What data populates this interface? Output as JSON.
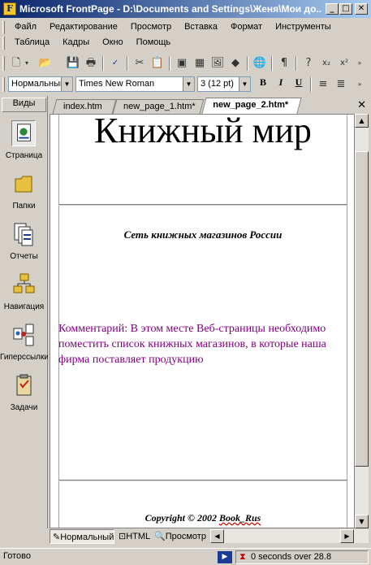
{
  "window": {
    "title": "Microsoft FrontPage - D:\\Documents and Settings\\Женя\\Мои до...",
    "minimize": "_",
    "maximize": "□",
    "close": "✕"
  },
  "menu": {
    "row1": [
      "Файл",
      "Редактирование",
      "Просмотр",
      "Вставка",
      "Формат",
      "Инструменты"
    ],
    "row2": [
      "Таблица",
      "Кадры",
      "Окно",
      "Помощь"
    ]
  },
  "format_toolbar": {
    "style": "Нормальный",
    "font": "Times New Roman",
    "size": "3  (12 pt)",
    "bold": "B",
    "italic": "I",
    "underline": "U"
  },
  "views": {
    "header": "Виды",
    "items": [
      "Страница",
      "Папки",
      "Отчеты",
      "Навигация",
      "Гиперссылки",
      "Задачи"
    ]
  },
  "tabs": [
    "index.htm",
    "new_page_1.htm*",
    "new_page_2.htm*"
  ],
  "page": {
    "heading": "Книжный мир",
    "subheading": "Сеть книжных магазинов России",
    "comment": "Комментарий: В этом месте Веб-страницы необходимо поместить список книжных магазинов, в которые наша фирма поставляет продукцию",
    "copyright_prefix": "Copyright © 2002 ",
    "copyright_name": "Book_Rus"
  },
  "modes": [
    "Нормальный",
    "HTML",
    "Просмотр"
  ],
  "status": {
    "left": "Готово",
    "right": "0 seconds over 28.8"
  }
}
